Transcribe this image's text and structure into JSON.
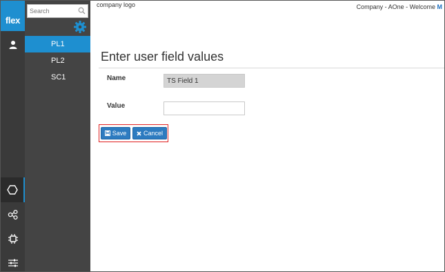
{
  "app": {
    "brand": "flex",
    "logo_text": "company logo",
    "welcome_text": "Company - AOne - Welcome",
    "welcome_user": "M",
    "accent": "#1e8fd0"
  },
  "rail": {
    "items": [
      {
        "icon": "user-icon"
      },
      {
        "icon": "hexagon-icon",
        "active": true
      },
      {
        "icon": "nodes-icon"
      },
      {
        "icon": "chip-icon"
      },
      {
        "icon": "sliders-icon"
      }
    ]
  },
  "tree": {
    "search_placeholder": "Search",
    "items": [
      {
        "label": "PL1",
        "selected": true
      },
      {
        "label": "PL2"
      },
      {
        "label": "SC1"
      }
    ]
  },
  "form": {
    "title": "Enter user field values",
    "name_label": "Name",
    "name_value": "TS Field 1",
    "value_label": "Value",
    "value_value": "",
    "save_label": "Save",
    "cancel_label": "Cancel"
  }
}
